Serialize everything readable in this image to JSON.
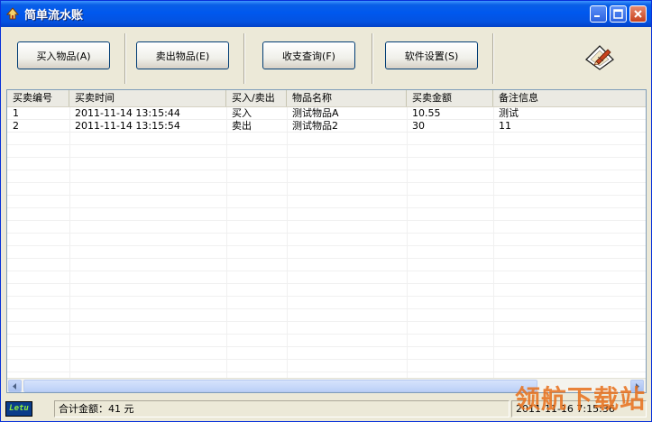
{
  "window": {
    "title": "简单流水账"
  },
  "toolbar": {
    "buttons": [
      {
        "label": "买入物品(A)"
      },
      {
        "label": "卖出物品(E)"
      },
      {
        "label": "收支查询(F)"
      },
      {
        "label": "软件设置(S)"
      }
    ]
  },
  "table": {
    "headers": [
      "买卖编号",
      "买卖时间",
      "买入/卖出",
      "物品名称",
      "买卖金额",
      "备注信息"
    ],
    "rows": [
      [
        "1",
        "2011-11-14 13:15:44",
        "买入",
        "测试物品A",
        "10.55",
        "测试"
      ],
      [
        "2",
        "2011-11-14 13:15:54",
        "卖出",
        "测试物品2",
        "30",
        "11"
      ]
    ]
  },
  "status": {
    "logo_text": "Letu",
    "total": "合计金额：41 元",
    "datetime": "2011-11-16 7:15:36"
  },
  "watermark": "领航下载站",
  "colors": {
    "titlebar": "#0058EE",
    "face": "#ECE9D8"
  }
}
